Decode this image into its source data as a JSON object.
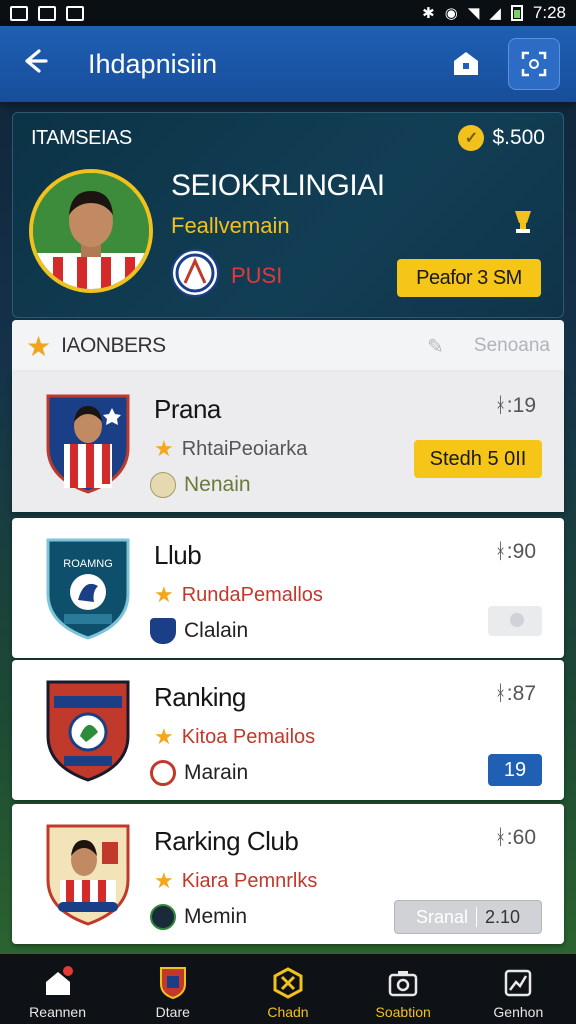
{
  "status_bar": {
    "time": "7:28"
  },
  "app_bar": {
    "title": "Ihdapnisiin"
  },
  "profile": {
    "label": "ITAMSEIAS",
    "coins": "$.500",
    "name": "SEIOKRLINGIAI",
    "role": "Feallvemain",
    "club_code": "PUSI",
    "button_label": "Peafor 3 SM"
  },
  "section": {
    "title": "IAONBERS",
    "link": "Senoana"
  },
  "cards": [
    {
      "title": "Prana",
      "stat": "ᚼ:19",
      "subtitle": "RhtaiPeoiarka",
      "meta": "Nenain",
      "button": "Stedh 5 0II",
      "colors": {
        "subtitle": "#555555",
        "meta": "#6a7a3a"
      }
    },
    {
      "title": "Llub",
      "stat": "ᚼ:90",
      "subtitle": "RundaPemallos",
      "meta": "Clalain",
      "colors": {
        "subtitle": "#c0392b",
        "meta": "#222222"
      }
    },
    {
      "title": "Ranking",
      "stat": "ᚼ:87",
      "subtitle": "Kitoa Pemailos",
      "meta": "Marain",
      "button": "19",
      "colors": {
        "subtitle": "#c0392b",
        "meta": "#222222"
      }
    },
    {
      "title": "Rarking Club",
      "stat": "ᚼ:60",
      "subtitle": "Kiara Pemnrlks",
      "meta": "Memin",
      "button_left": "Sranal",
      "button_right": "2.10",
      "colors": {
        "subtitle": "#c0392b",
        "meta": "#222222"
      }
    }
  ],
  "nav": [
    {
      "label": "Reannen",
      "icon": "home-icon"
    },
    {
      "label": "Dtare",
      "icon": "shield-icon"
    },
    {
      "label": "Chadn",
      "icon": "hexagon-icon"
    },
    {
      "label": "Soabtion",
      "icon": "camera-icon"
    },
    {
      "label": "Genhon",
      "icon": "chart-icon"
    }
  ],
  "accent_colors": {
    "primary_blue": "#1f5fb4",
    "gold": "#f5c518",
    "red": "#c0392b"
  }
}
